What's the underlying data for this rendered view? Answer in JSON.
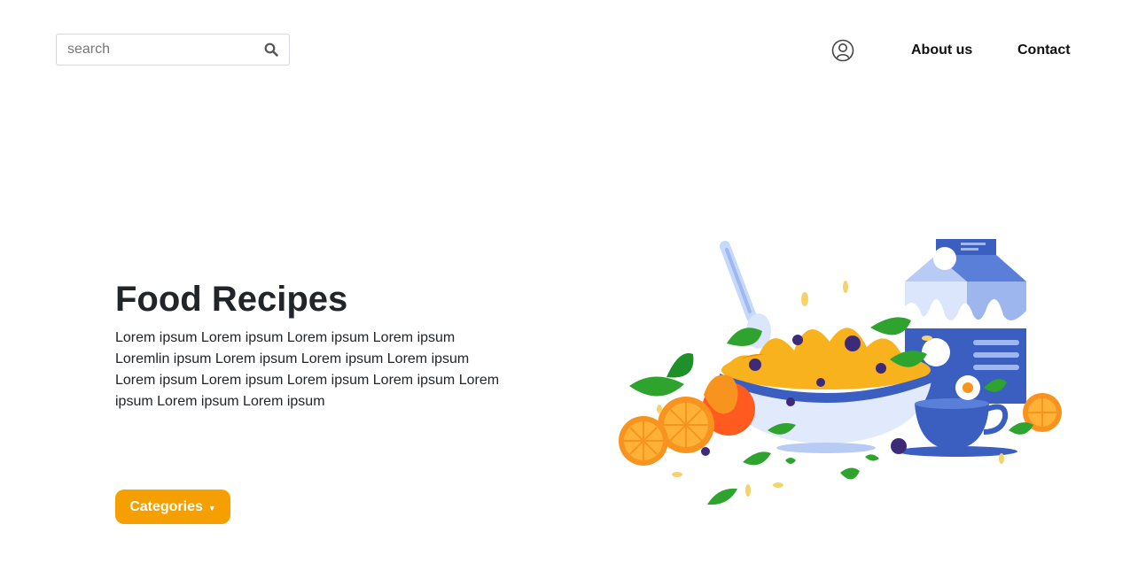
{
  "header": {
    "search": {
      "placeholder": "search",
      "value": "",
      "icon": "search-icon"
    },
    "user_icon": "user-icon",
    "nav": [
      {
        "label": "About us"
      },
      {
        "label": "Contact"
      }
    ]
  },
  "hero": {
    "title": "Food Recipes",
    "description": "Lorem ipsum Lorem ipsum Lorem ipsum Lorem ipsum Loremlin ipsum Lorem ipsum Lorem ipsum Lorem ipsum Lorem ipsum Lorem ipsum Lorem ipsum Lorem ipsum Lorem ipsum Lorem ipsum Lorem ipsum",
    "categories_button": "Categories",
    "illustration": "breakfast-cereal-illustration"
  },
  "colors": {
    "accent": "#f59f00",
    "text": "#212529",
    "milk_blue": "#3b5fc0",
    "orange": "#f7931e",
    "leaf_green": "#2ea32e"
  }
}
